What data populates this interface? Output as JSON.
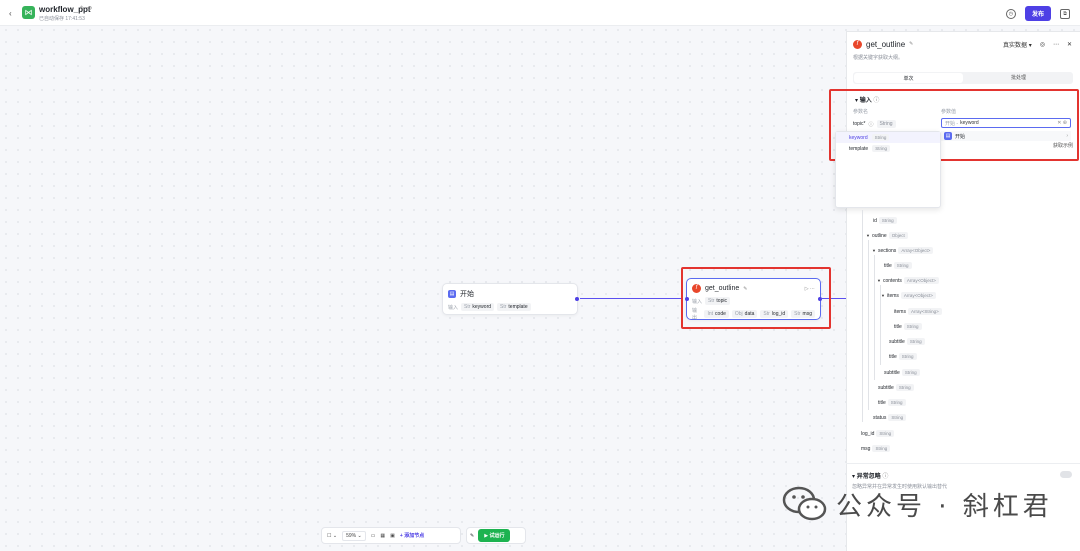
{
  "topbar": {
    "title": "workflow_ppt",
    "subtitle": "已自动保存 17:41:53",
    "publish_label": "发布"
  },
  "nodes": {
    "start": {
      "title": "开始",
      "input_label": "输入",
      "inputs": [
        {
          "type": "Str",
          "name": "keyword"
        },
        {
          "type": "Str",
          "name": "template"
        }
      ]
    },
    "get_outline": {
      "title": "get_outline",
      "input_label": "输入",
      "inputs": [
        {
          "type": "Str",
          "name": "topic"
        }
      ],
      "output_label": "输出",
      "outputs": [
        {
          "type": "Int",
          "name": "code"
        },
        {
          "type": "Obj",
          "name": "data"
        },
        {
          "type": "Str",
          "name": "log_id"
        },
        {
          "type": "Str",
          "name": "msg"
        }
      ]
    }
  },
  "panel": {
    "title": "get_outline",
    "description": "根据关键字获取大纲。",
    "data_menu": "真实数据",
    "tabs": [
      "单次",
      "批处理"
    ],
    "input_section": "输入",
    "col_param": "参数名",
    "col_value": "参数值",
    "param_name": "topic*",
    "param_type": "String",
    "value_prefix": "开始 -",
    "value": "keyword",
    "ref_node": "开始",
    "side_hint": "获取示例",
    "dropdown": [
      {
        "name": "keyword",
        "type": "String"
      },
      {
        "name": "template",
        "type": "String"
      }
    ],
    "tree": [
      {
        "name": "id",
        "type": "String"
      },
      {
        "name": "outline",
        "type": "Object"
      },
      {
        "name": "sections",
        "type": "Array<Object>"
      },
      {
        "name": "title",
        "type": "String"
      },
      {
        "name": "contents",
        "type": "Array<Object>"
      },
      {
        "name": "items",
        "type": "Array<Object>"
      },
      {
        "name": "items",
        "type": "Array<String>"
      },
      {
        "name": "title",
        "type": "String"
      },
      {
        "name": "subtitle",
        "type": "String"
      },
      {
        "name": "title",
        "type": "String"
      },
      {
        "name": "subtitle",
        "type": "String"
      },
      {
        "name": "subtitle",
        "type": "String"
      },
      {
        "name": "title",
        "type": "String"
      },
      {
        "name": "status",
        "type": "String"
      },
      {
        "name": "log_id",
        "type": "String"
      },
      {
        "name": "msg",
        "type": "String"
      }
    ],
    "exception_section": "异常忽略",
    "exception_desc": "忽略异常并在异常发生时使用默认输出替代"
  },
  "toolbar": {
    "zoom": "59%",
    "add_node": "添加节点",
    "run": "试运行"
  },
  "watermark": {
    "text": "公众号 · 斜杠君"
  },
  "colors": {
    "accent": "#4e40e5",
    "run": "#1db350",
    "highlight": "#e3342f",
    "fn_icon": "#e8472b"
  }
}
